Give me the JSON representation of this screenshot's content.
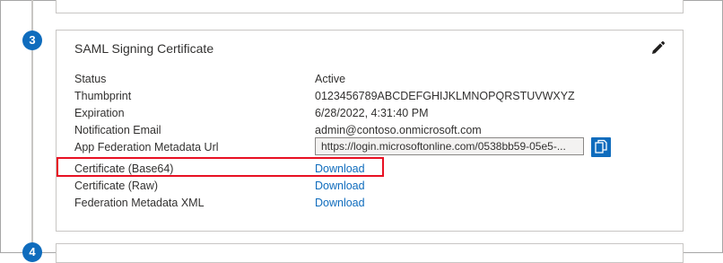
{
  "steps": {
    "current_number": "3",
    "next_number": "4"
  },
  "card": {
    "title": "SAML Signing Certificate",
    "rows": [
      {
        "label": "Status",
        "value": "Active"
      },
      {
        "label": "Thumbprint",
        "value": "0123456789ABCDEFGHIJKLMNOPQRSTUVWXYZ"
      },
      {
        "label": "Expiration",
        "value": "6/28/2022, 4:31:40 PM"
      },
      {
        "label": "Notification Email",
        "value": "admin@contoso.onmicrosoft.com"
      },
      {
        "label": "App Federation Metadata Url",
        "value": "https://login.microsoftonline.com/0538bb59-05e5-..."
      },
      {
        "label": "Certificate (Base64)",
        "value": "Download"
      },
      {
        "label": "Certificate (Raw)",
        "value": "Download"
      },
      {
        "label": "Federation Metadata XML",
        "value": "Download"
      }
    ]
  },
  "icons": {
    "edit": "pencil-icon",
    "copy": "copy-icon"
  },
  "colors": {
    "accent": "#0f6cbd",
    "highlight": "#e81123",
    "link": "#0f6cbd"
  }
}
